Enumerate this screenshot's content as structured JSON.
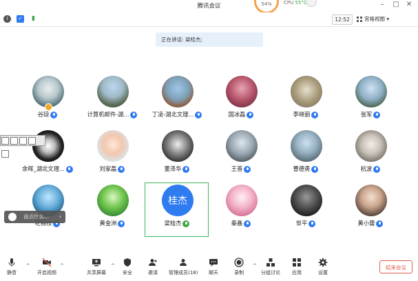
{
  "app": {
    "title": "腾讯会议",
    "cpu_label": "CPU",
    "cpu_temp": "55°C",
    "cpu_ring_text": "54%"
  },
  "toolbar": {
    "time": "12:52",
    "view_label": "宫格视图"
  },
  "speaking": "正在讲话: 梁桂杰;",
  "participants": [
    {
      "name": "谷琼"
    },
    {
      "name": "计算机邮件-湖..."
    },
    {
      "name": "丁凌-湖北文理..."
    },
    {
      "name": "国冰磊"
    },
    {
      "name": "李晓丽"
    },
    {
      "name": "张军"
    },
    {
      "name": "余晖_湖北文理..."
    },
    {
      "name": "刘家磊"
    },
    {
      "name": "董泽华"
    },
    {
      "name": "王普"
    },
    {
      "name": "曹德勇"
    },
    {
      "name": "杭波"
    },
    {
      "name": "花锦枝"
    },
    {
      "name": "黄金洲"
    },
    {
      "name": "梁桂杰",
      "avatar_text": "桂杰"
    },
    {
      "name": "秦鑫"
    },
    {
      "name": "世平"
    },
    {
      "name": "黄小蕾"
    }
  ],
  "chat_popup": "说点什么...",
  "bottom": {
    "mute": "静音",
    "video": "开启视频",
    "share": "共享屏幕",
    "security": "安全",
    "invite": "邀请",
    "members": "管理成员(18)",
    "chat": "聊天",
    "record": "录制",
    "breakout": "分组讨论",
    "apps": "应用",
    "settings": "设置",
    "end": "结束会议"
  },
  "colors": {
    "accent": "#2f7bf0",
    "active_border": "#3fb35a",
    "end": "#e05a4f"
  }
}
